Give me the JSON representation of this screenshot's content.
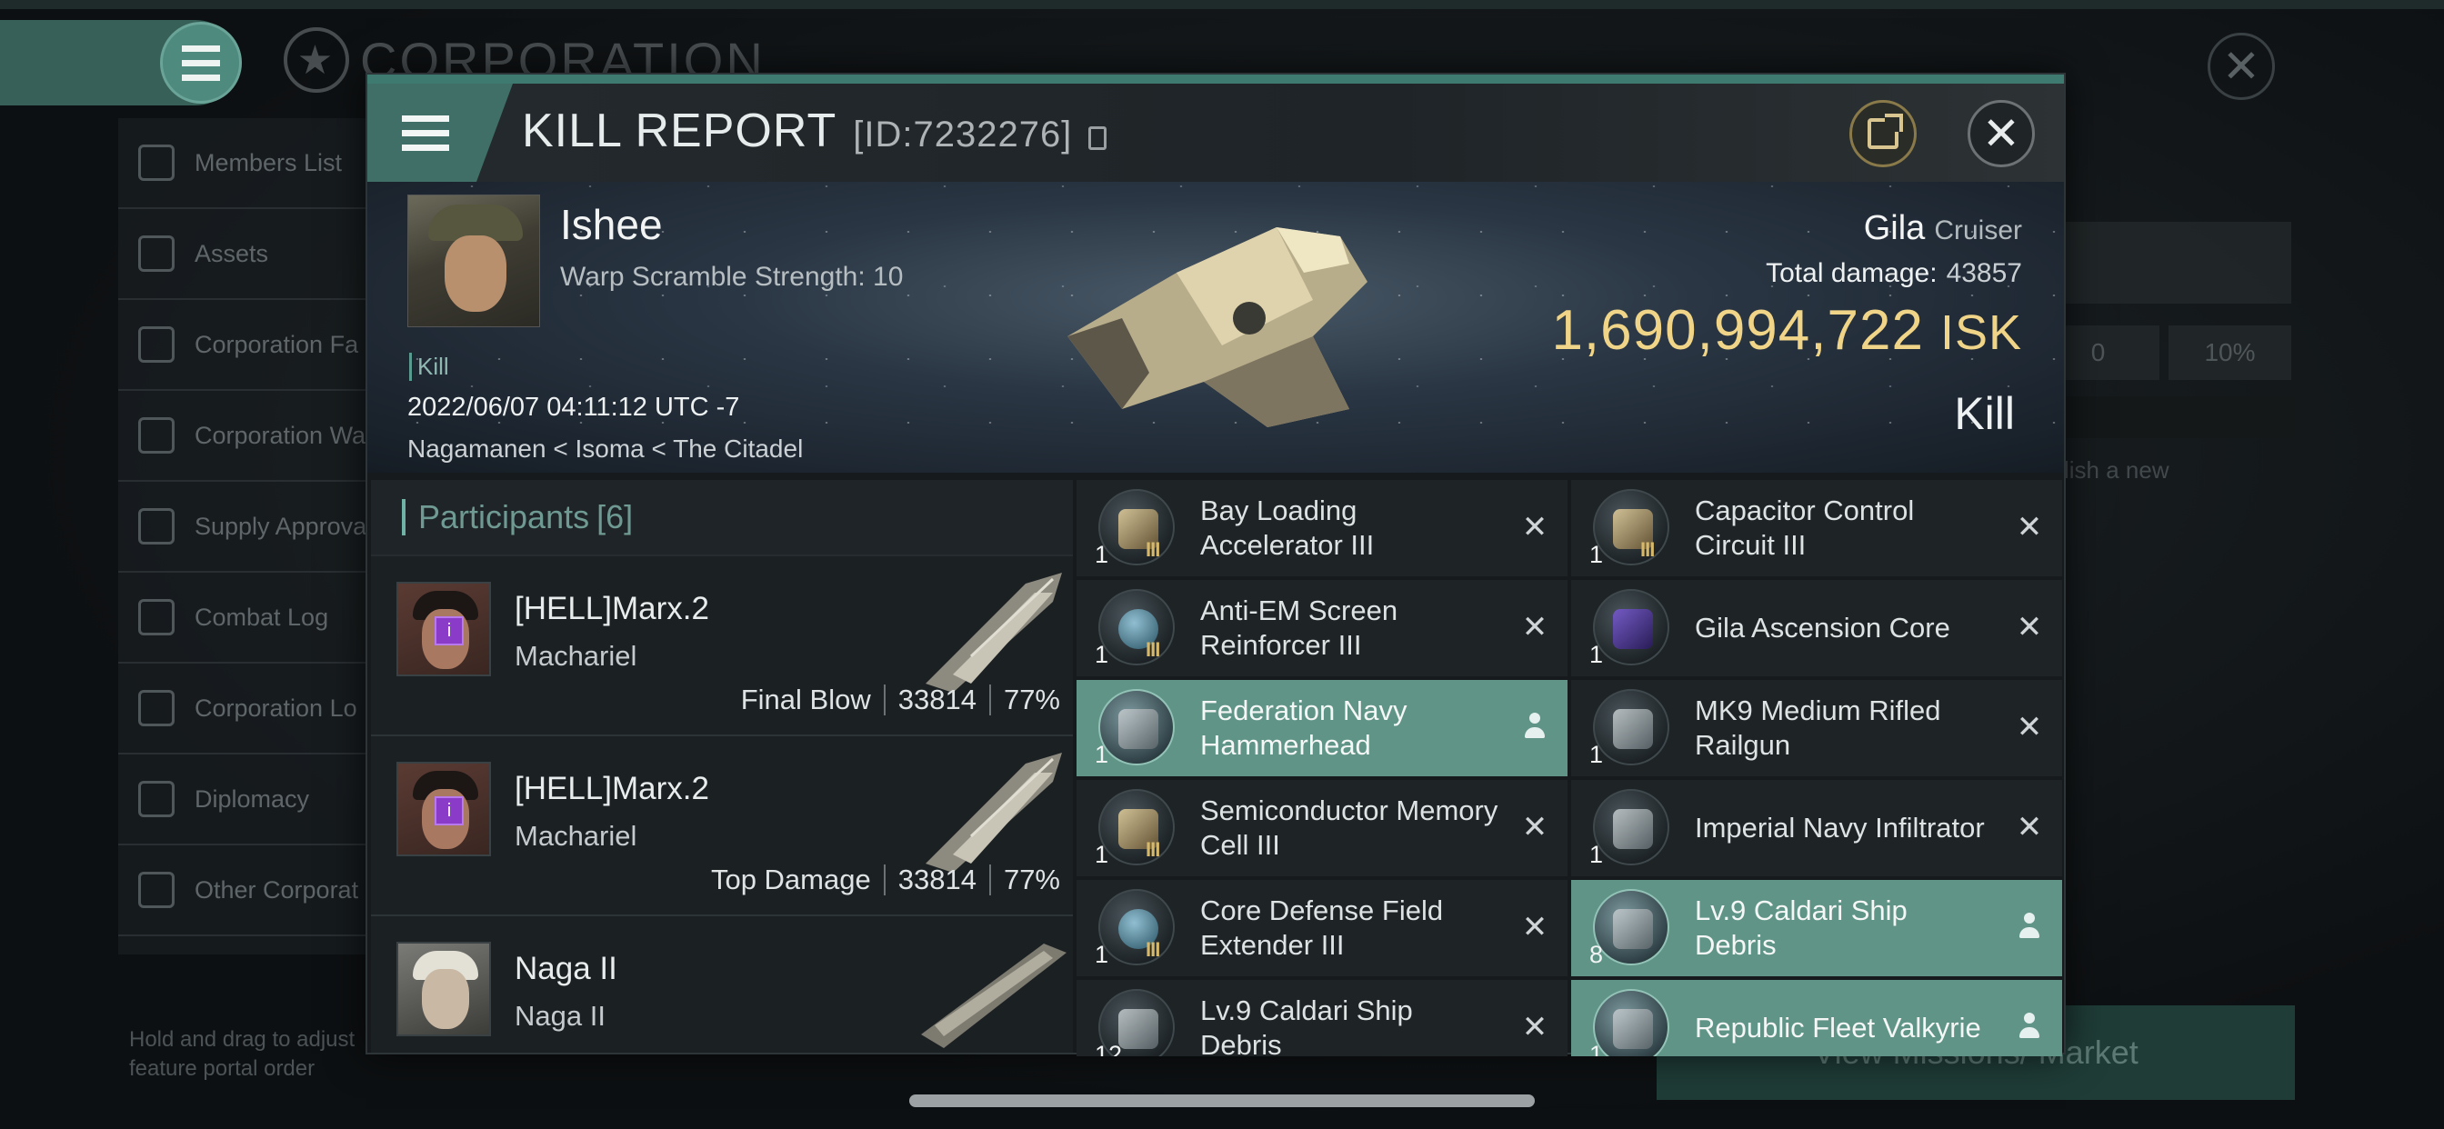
{
  "background": {
    "title": "CORPORATION",
    "sidebar": [
      {
        "label": "Members List",
        "icon": "members-icon"
      },
      {
        "label": "Assets",
        "icon": "assets-icon"
      },
      {
        "label": "Corporation Fa",
        "icon": "facilities-icon"
      },
      {
        "label": "Corporation Wa",
        "icon": "wallet-icon"
      },
      {
        "label": "Supply Approva",
        "icon": "supply-icon"
      },
      {
        "label": "Combat Log",
        "icon": "combat-icon"
      },
      {
        "label": "Corporation Lo",
        "icon": "log-icon"
      },
      {
        "label": "Diplomacy",
        "icon": "diplomacy-icon"
      },
      {
        "label": "Other Corporat",
        "icon": "star-icon"
      }
    ],
    "hint": "Hold and drag to adjust feature portal order",
    "right_values": [
      "0",
      "10%"
    ],
    "right_text": "lish a new",
    "mission_button": "View Missions/ Market"
  },
  "modal": {
    "title": "KILL REPORT",
    "id_text": "[ID:7232276]",
    "victim": {
      "name": "Ishee",
      "warp_scramble": "Warp Scramble Strength: 10",
      "tag": "Kill",
      "datetime": "2022/06/07 04:11:12 UTC -7",
      "location": "Nagamanen < Isoma < The Citadel"
    },
    "ship": {
      "name": "Gila",
      "class": "Cruiser",
      "total_damage_label": "Total damage:",
      "total_damage": "43857",
      "isk_value": "1,690,994,722",
      "isk_unit": "ISK",
      "result": "Kill"
    },
    "participants": {
      "title": "Participants",
      "count": "[6]",
      "rows": [
        {
          "name": "[HELL]Marx.2",
          "ship": "Machariel",
          "label": "Final Blow",
          "damage": "33814",
          "percent": "77%"
        },
        {
          "name": "[HELL]Marx.2",
          "ship": "Machariel",
          "label": "Top Damage",
          "damage": "33814",
          "percent": "77%"
        },
        {
          "name": "Naga II",
          "ship": "Naga II",
          "label": "",
          "damage": "",
          "percent": ""
        }
      ]
    },
    "items": [
      {
        "name": "Bay Loading Accelerator III",
        "qty": "1",
        "meta": "III",
        "state": "destroyed",
        "icon": "gold"
      },
      {
        "name": "Capacitor Control Circuit III",
        "qty": "1",
        "meta": "III",
        "state": "destroyed",
        "icon": "gold"
      },
      {
        "name": "Anti-EM Screen Reinforcer III",
        "qty": "1",
        "meta": "III",
        "state": "destroyed",
        "icon": "blue"
      },
      {
        "name": "Gila Ascension Core",
        "qty": "1",
        "meta": "",
        "state": "destroyed",
        "icon": "purple"
      },
      {
        "name": "Federation Navy Hammerhead",
        "qty": "1",
        "meta": "",
        "state": "dropped",
        "icon": "drone"
      },
      {
        "name": "MK9 Medium Rifled Railgun",
        "qty": "1",
        "meta": "",
        "state": "destroyed",
        "icon": "gun"
      },
      {
        "name": "Semiconductor Memory Cell III",
        "qty": "1",
        "meta": "III",
        "state": "destroyed",
        "icon": "gold"
      },
      {
        "name": "Imperial Navy Infiltrator",
        "qty": "1",
        "meta": "",
        "state": "destroyed",
        "icon": "drone"
      },
      {
        "name": "Core Defense Field Extender III",
        "qty": "1",
        "meta": "III",
        "state": "destroyed",
        "icon": "blue"
      },
      {
        "name": "Lv.9 Caldari Ship Debris",
        "qty": "8",
        "meta": "",
        "state": "dropped",
        "icon": "debris"
      },
      {
        "name": "Lv.9 Caldari Ship Debris",
        "qty": "12",
        "meta": "",
        "state": "destroyed",
        "icon": "debris"
      },
      {
        "name": "Republic Fleet Valkyrie",
        "qty": "1",
        "meta": "",
        "state": "dropped",
        "icon": "drone"
      }
    ]
  }
}
